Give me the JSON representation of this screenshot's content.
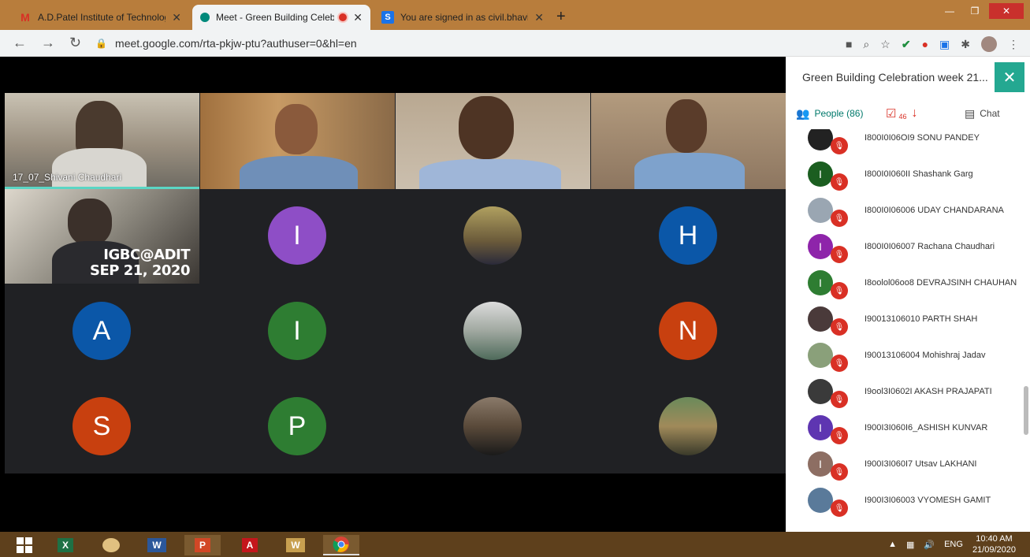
{
  "browser": {
    "tabs": [
      {
        "title": "A.D.Patel Institute of Technology",
        "favicon": "gmail-icon",
        "close": "✕"
      },
      {
        "title": "Meet - Green Building Celeb",
        "favicon": "meet-icon",
        "close": "✕"
      },
      {
        "title": "You are signed in as civil.bhavin",
        "favicon": "S",
        "close": "✕"
      }
    ],
    "new_tab": "+",
    "url": "meet.google.com/rta-pkjw-ptu?authuser=0&hl=en"
  },
  "meet": {
    "tiles": {
      "shivani_name": "17_07_Shivani Chaudhari",
      "igbc_line1": "IGBC@ADIT",
      "igbc_line2": "SEP 21, 2020"
    },
    "avatars": [
      {
        "letter": "I",
        "color": "#8e4ec6"
      },
      {
        "letter": "H",
        "color": "#0b57a8"
      },
      {
        "letter": "A",
        "color": "#0b57a8"
      },
      {
        "letter": "I",
        "color": "#2e7d32"
      },
      {
        "letter": "N",
        "color": "#c8400f"
      },
      {
        "letter": "S",
        "color": "#c8400f"
      },
      {
        "letter": "P",
        "color": "#2e7d32"
      }
    ]
  },
  "panel": {
    "title": "Green Building Celebration week 21...",
    "close": "✕",
    "people_tab": "People (86)",
    "tasks_count": "46",
    "chat_tab": "Chat",
    "participants": [
      {
        "name": "I800I0I06OI9 SONU PANDEY",
        "letter": "",
        "color": "#222"
      },
      {
        "name": "I800I0I060II Shashank Garg",
        "letter": "I",
        "color": "#1b5e20"
      },
      {
        "name": "I800I0I06006 UDAY CHANDARANA",
        "letter": "",
        "color": "#9aa6b2"
      },
      {
        "name": "I800I0I06007 Rachana Chaudhari",
        "letter": "I",
        "color": "#8e24aa"
      },
      {
        "name": "I8oolol06oo8 DEVRAJSINH CHAUHAN",
        "letter": "I",
        "color": "#2e7d32"
      },
      {
        "name": "I90013106010 PARTH SHAH",
        "letter": "",
        "color": "#4a3a3a"
      },
      {
        "name": "I90013106004 Mohishraj Jadav",
        "letter": "",
        "color": "#8aa07a"
      },
      {
        "name": "I9ool3I0602I AKASH PRAJAPATI",
        "letter": "",
        "color": "#3a3a3a"
      },
      {
        "name": "I900I3I060I6_ASHISH KUNVAR",
        "letter": "I",
        "color": "#5e35b1"
      },
      {
        "name": "I900I3I060I7 Utsav LAKHANI",
        "letter": "I",
        "color": "#8d6e63"
      },
      {
        "name": "I900I3I06003 VYOMESH GAMIT",
        "letter": "",
        "color": "#5a7a9a"
      }
    ]
  },
  "taskbar": {
    "lang": "ENG",
    "time": "10:40 AM",
    "date": "21/09/2020"
  }
}
